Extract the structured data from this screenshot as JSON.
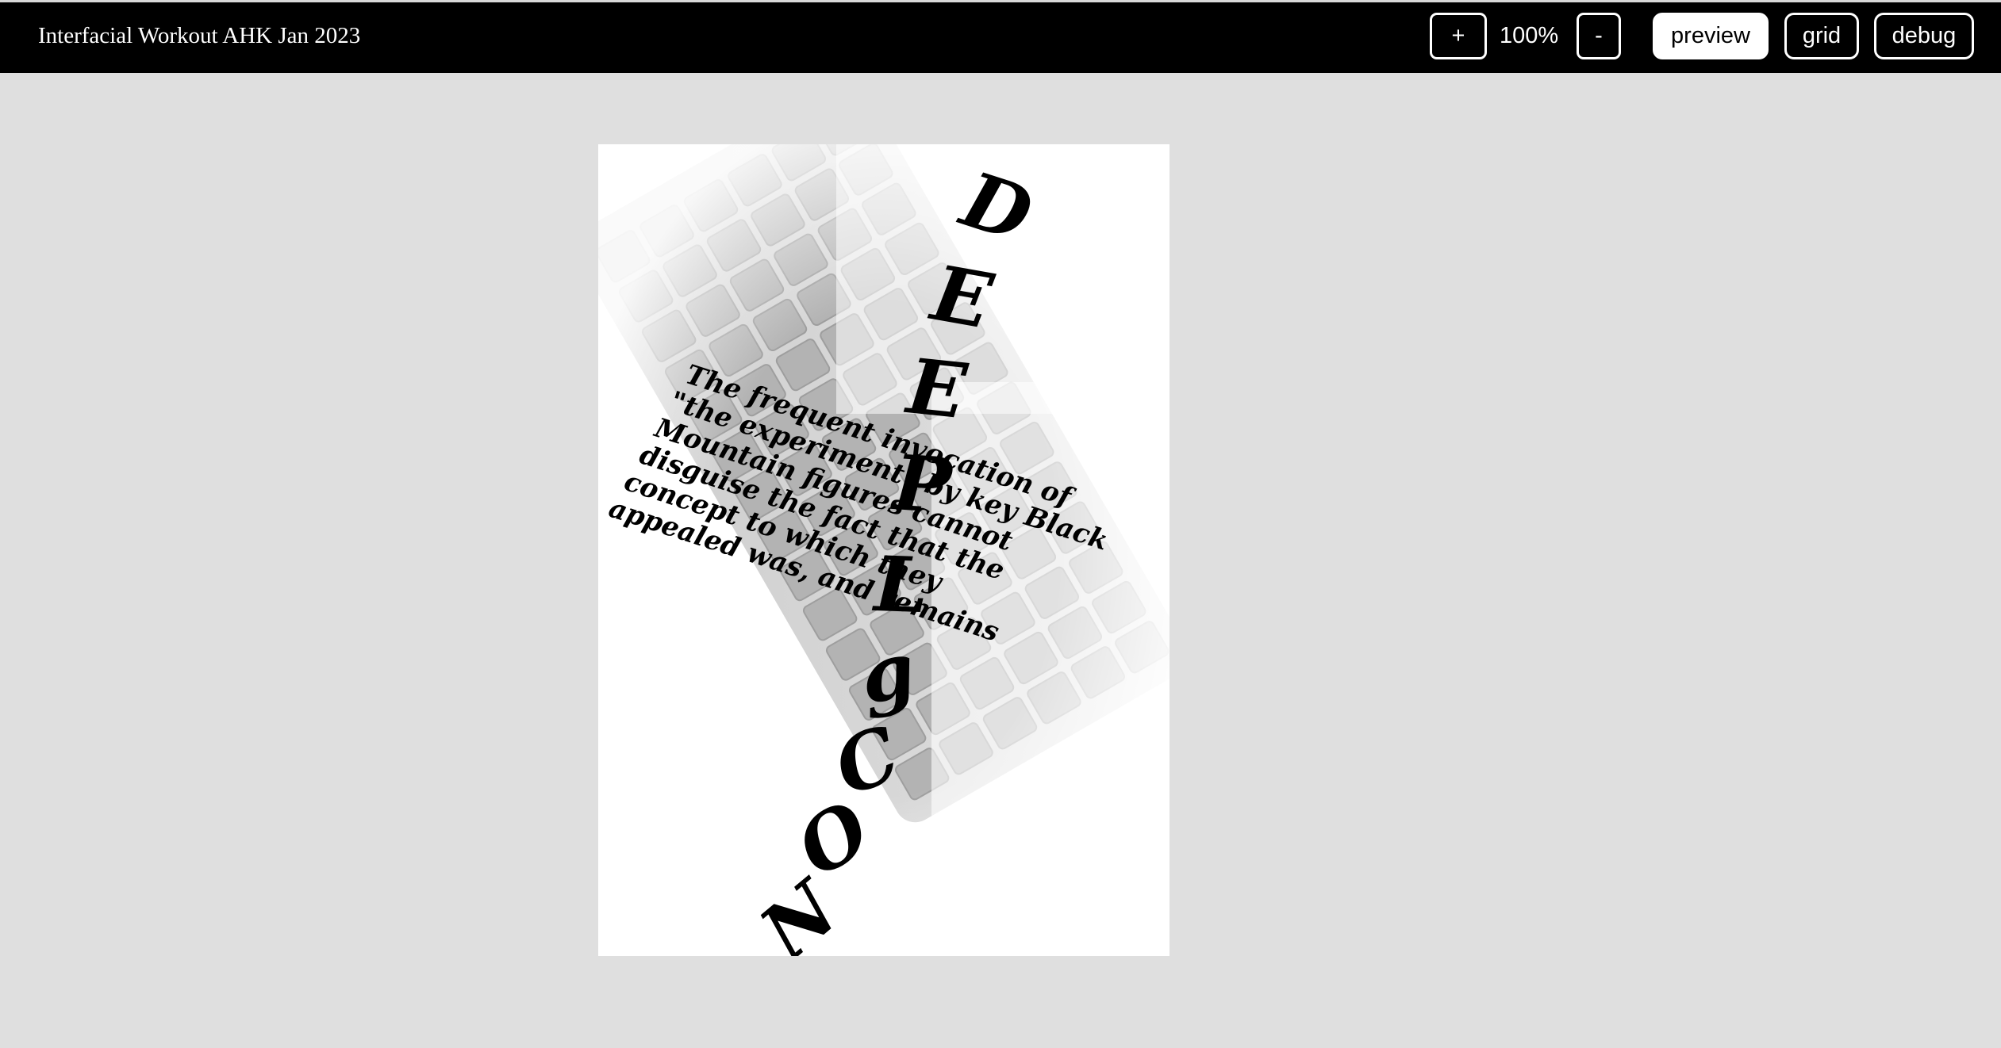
{
  "app": {
    "title": "Interfacial Workout AHK Jan 2023"
  },
  "toolbar": {
    "zoom_in_label": "+",
    "zoom_level": "100%",
    "zoom_out_label": "-",
    "preview_label": "preview",
    "grid_label": "grid",
    "debug_label": "debug",
    "active_mode": "preview"
  },
  "poster": {
    "vertical_letters": [
      "D",
      "E",
      "E",
      "P",
      "L",
      "g",
      "C",
      "O",
      "N"
    ],
    "paragraph_lines": [
      "The frequent invocation of",
      "\"the experiment\" by key Black",
      "Mountain figures cannot",
      "disguise the fact that the",
      "concept to which they",
      "appealed was, and remains"
    ],
    "image": "keyboard-photo"
  },
  "colors": {
    "topbar": "#000000",
    "workspace": "#dfdfdf",
    "poster_background": "#ffffff",
    "text": "#000000"
  }
}
